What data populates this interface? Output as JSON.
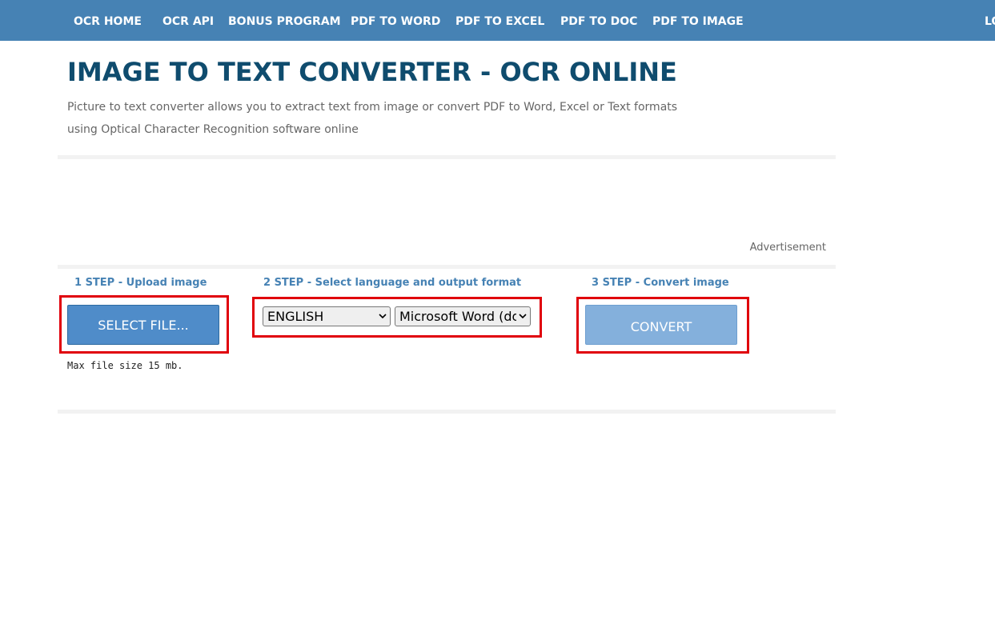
{
  "nav": {
    "items": [
      "OCR HOME",
      "OCR API",
      "BONUS PROGRAM",
      "PDF TO WORD",
      "PDF TO EXCEL",
      "PDF TO DOC",
      "PDF TO IMAGE"
    ],
    "login_partial": "LO"
  },
  "header": {
    "title": "IMAGE TO TEXT CONVERTER - OCR ONLINE",
    "subtitle": "Picture to text converter allows you to extract text from image or convert PDF to Word, Excel or Text formats using Optical Character Recognition software online"
  },
  "ad": {
    "label": "Advertisement"
  },
  "steps": {
    "step1": {
      "label": "1 STEP - Upload image",
      "button": "SELECT FILE...",
      "note": "Max file size 15 mb."
    },
    "step2": {
      "label": "2 STEP - Select language and output format",
      "language_selected": "ENGLISH",
      "format_selected": "Microsoft Word (docx)"
    },
    "step3": {
      "label": "3 STEP - Convert image",
      "button": "CONVERT"
    }
  },
  "colors": {
    "nav_bg": "#4682b4",
    "title": "#0f4c6e",
    "step_label": "#4682b4",
    "select_button": "#4f8cc9",
    "convert_button": "#84b0dc",
    "highlight": "#e0000b"
  },
  "icons": {
    "select_chevron": "chevron-down-icon"
  }
}
